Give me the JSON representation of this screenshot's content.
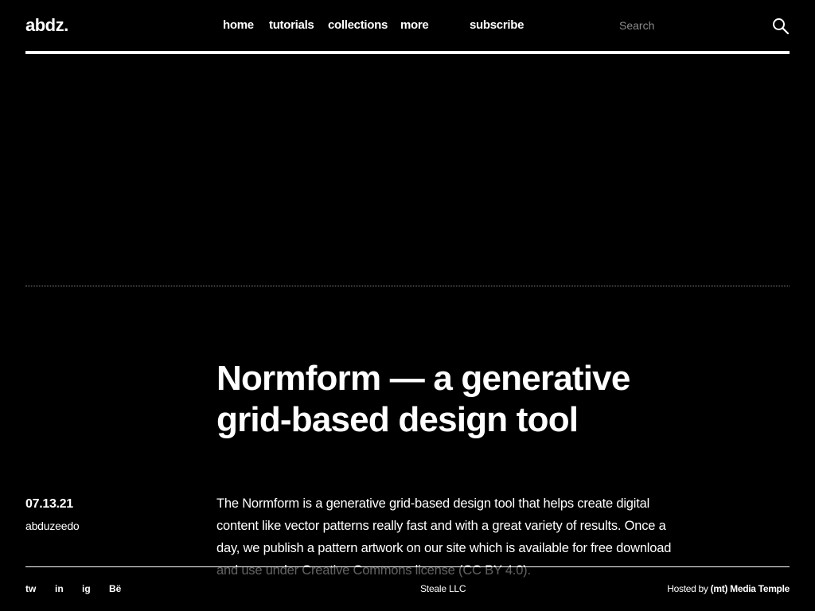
{
  "header": {
    "logo": "abdz.",
    "nav": {
      "home": "home",
      "tutorials": "tutorials",
      "collections": "collections",
      "more": "more",
      "subscribe": "subscribe"
    },
    "search": {
      "placeholder": "Search",
      "icon": "search-icon"
    }
  },
  "article": {
    "title": "Normform — a generative grid-based design tool",
    "date": "07.13.21",
    "author": "abduzeedo",
    "body": "The Normform is a generative grid-based design tool that helps create digital content like vector patterns really fast and with a great variety of results. Once a day, we publish a pattern artwork on our site which is available for free download and use under Creative Commons license (CC BY 4.0)."
  },
  "footer": {
    "social": {
      "tw": "tw",
      "in": "in",
      "ig": "ig",
      "be": "Bë"
    },
    "company": "Steale LLC",
    "hosted_prefix": "Hosted by",
    "hosted_by": "(mt) Media Temple"
  },
  "colors": {
    "background": "#000000",
    "text": "#ffffff",
    "muted": "#8a8a8a"
  }
}
